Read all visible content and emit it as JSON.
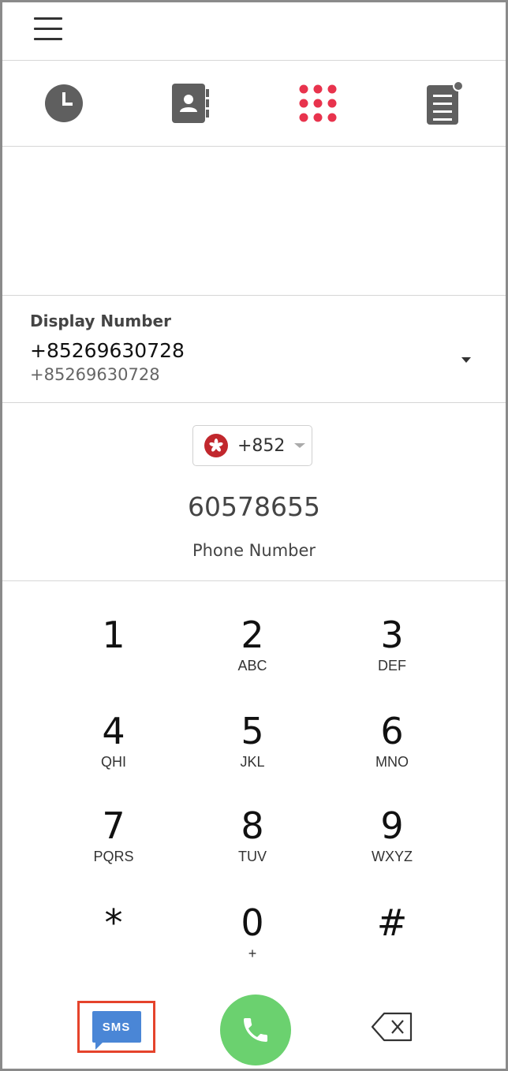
{
  "header": {
    "menu_icon": "hamburger-menu-icon"
  },
  "tabs": [
    {
      "name": "recents",
      "icon": "clock-icon"
    },
    {
      "name": "contacts",
      "icon": "contact-book-icon"
    },
    {
      "name": "keypad",
      "icon": "keypad-grid-icon",
      "active": true,
      "color": "#e8334d"
    },
    {
      "name": "voicemail",
      "icon": "document-notification-icon"
    }
  ],
  "display_number": {
    "label": "Display Number",
    "primary": "+85269630728",
    "secondary": "+85269630728"
  },
  "dialer": {
    "country_code": "+852",
    "country_flag": "hong-kong-flag-icon",
    "entered_number": "60578655",
    "entry_label": "Phone Number"
  },
  "keypad": [
    {
      "digit": "1",
      "letters": ""
    },
    {
      "digit": "2",
      "letters": "ABC"
    },
    {
      "digit": "3",
      "letters": "DEF"
    },
    {
      "digit": "4",
      "letters": "QHI"
    },
    {
      "digit": "5",
      "letters": "JKL"
    },
    {
      "digit": "6",
      "letters": "MNO"
    },
    {
      "digit": "7",
      "letters": "PQRS"
    },
    {
      "digit": "8",
      "letters": "TUV"
    },
    {
      "digit": "9",
      "letters": "WXYZ"
    },
    {
      "digit": "*",
      "letters": ""
    },
    {
      "digit": "0",
      "letters": "+"
    },
    {
      "digit": "#",
      "letters": ""
    }
  ],
  "actions": {
    "sms_label": "SMS",
    "call_color": "#6bd16f",
    "sms_color": "#4a86d6",
    "highlight_color": "#e5432b"
  }
}
